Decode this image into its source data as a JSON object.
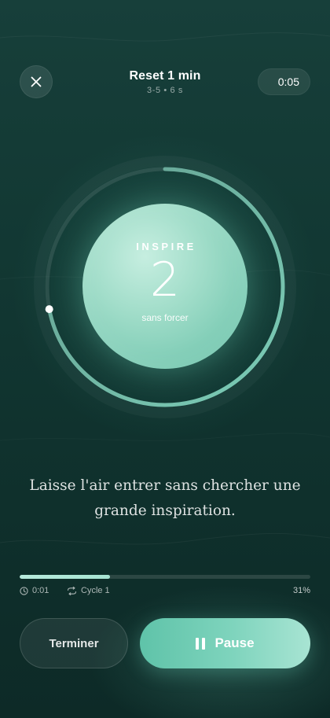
{
  "header": {
    "title": "Reset 1 min",
    "subtitle": "3-5 • 6 s",
    "timer": "0:05",
    "close_icon": "close-icon"
  },
  "breathing": {
    "phase": "INSPIRE",
    "count": "2",
    "hint": "sans forcer",
    "ring_progress": 0.72
  },
  "instruction": "Laisse l'air entrer sans chercher une grande inspiration.",
  "progress": {
    "fraction": 0.31,
    "elapsed": "0:01",
    "cycle": "Cycle 1",
    "percent": "31%"
  },
  "actions": {
    "end_label": "Terminer",
    "pause_label": "Pause"
  },
  "icons": {
    "clock": "clock-icon",
    "cycle": "repeat-icon",
    "pause": "pause-icon"
  },
  "colors": {
    "accent": "#7fd4bd",
    "accent_light": "#b7eadc",
    "background": "#123833"
  }
}
